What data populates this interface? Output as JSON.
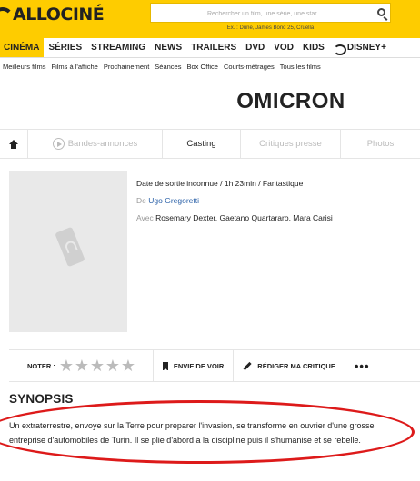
{
  "header": {
    "logo_text": "ALLOCINÉ",
    "search_placeholder": "Rechercher un film, une série, une star...",
    "search_hint": "Ex. : Dune, James Bond 25, Cruella"
  },
  "main_nav": [
    {
      "label": "CINÉMA",
      "active": true
    },
    {
      "label": "SÉRIES"
    },
    {
      "label": "STREAMING"
    },
    {
      "label": "NEWS"
    },
    {
      "label": "TRAILERS"
    },
    {
      "label": "DVD"
    },
    {
      "label": "VOD"
    },
    {
      "label": "KIDS"
    },
    {
      "label": "DISNEY+"
    }
  ],
  "sub_nav": [
    "Meilleurs films",
    "Films à l'affiche",
    "Prochainement",
    "Séances",
    "Box Office",
    "Courts-métrages",
    "Tous les films"
  ],
  "movie": {
    "title": "OMICRON",
    "release_line": "Date de sortie inconnue / 1h 23min / Fantastique",
    "director_prefix": "De",
    "director": "Ugo Gregoretti",
    "cast_prefix": "Avec",
    "cast": "Rosemary Dexter, Gaetano Quartararo, Mara Carisi"
  },
  "tabs": [
    {
      "label": "",
      "icon": "home-icon"
    },
    {
      "label": "Bandes-annonces",
      "icon": "play-icon"
    },
    {
      "label": "Casting",
      "active": true
    },
    {
      "label": "Critiques presse"
    },
    {
      "label": "Photos"
    }
  ],
  "rating": {
    "label": "NOTER :",
    "stars": 5,
    "wishlist_label": "ENVIE DE VOIR",
    "review_label": "RÉDIGER MA CRITIQUE",
    "more_label": "•••"
  },
  "synopsis": {
    "title": "SYNOPSIS",
    "text": "Un extraterrestre, envoye sur la Terre pour preparer l'invasion, se transforme en ouvrier d'une grosse entreprise d'automobiles de Turin. Il se plie d'abord a la discipline puis il s'humanise et se rebelle."
  },
  "colors": {
    "brand_yellow": "#fecc00",
    "link_blue": "#2b61a8",
    "annotation_red": "#dd1a1a"
  }
}
